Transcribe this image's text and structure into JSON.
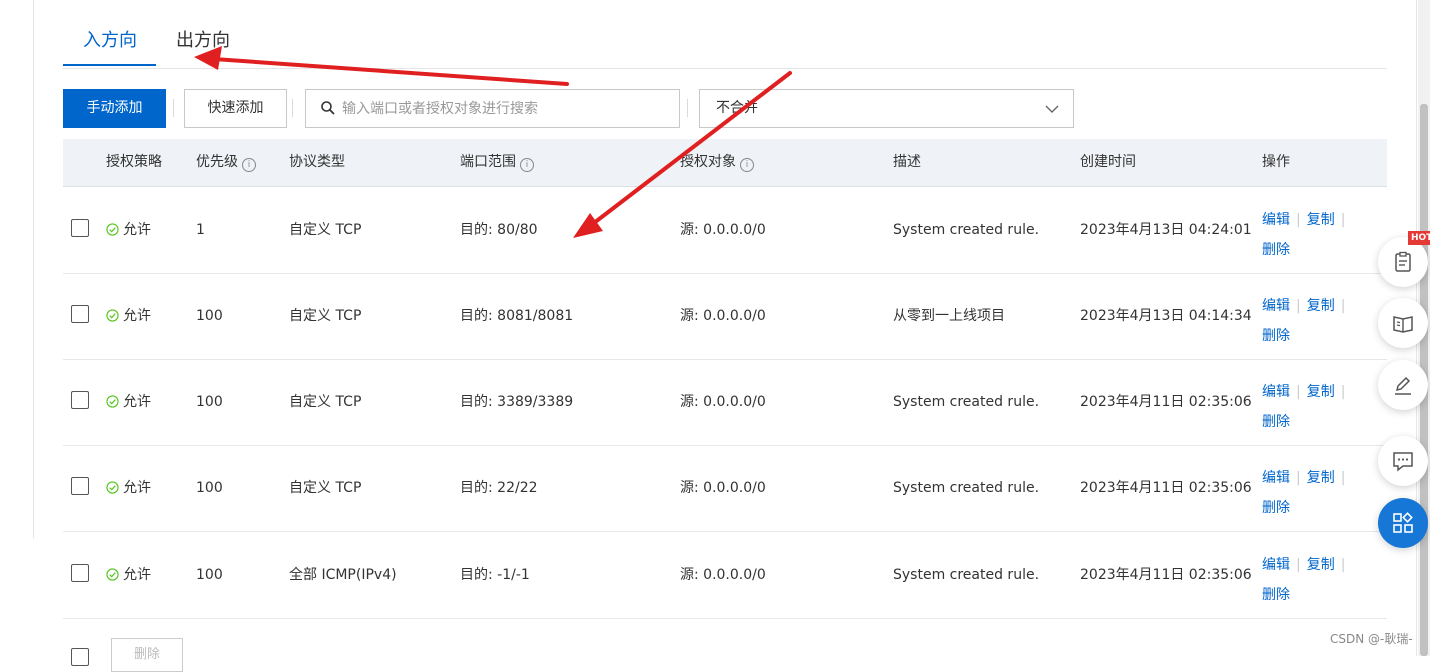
{
  "tabs": {
    "inbound": "入方向",
    "outbound": "出方向"
  },
  "toolbar": {
    "manual_add": "手动添加",
    "quick_add": "快速添加",
    "search_placeholder": "输入端口或者授权对象进行搜索",
    "merge_select_value": "不合并"
  },
  "table": {
    "headers": {
      "policy": "授权策略",
      "priority": "优先级",
      "protocol": "协议类型",
      "port_range": "端口范围",
      "auth_object": "授权对象",
      "description": "描述",
      "created_time": "创建时间",
      "actions": "操作"
    },
    "rows": [
      {
        "policy": "允许",
        "priority": "1",
        "protocol": "自定义 TCP",
        "port": "目的: 80/80",
        "source": "源: 0.0.0.0/0",
        "description": "System created rule.",
        "created": "2023年4月13日 04:24:01"
      },
      {
        "policy": "允许",
        "priority": "100",
        "protocol": "自定义 TCP",
        "port": "目的: 8081/8081",
        "source": "源: 0.0.0.0/0",
        "description": "从零到一上线项目",
        "created": "2023年4月13日 04:14:34"
      },
      {
        "policy": "允许",
        "priority": "100",
        "protocol": "自定义 TCP",
        "port": "目的: 3389/3389",
        "source": "源: 0.0.0.0/0",
        "description": "System created rule.",
        "created": "2023年4月11日 02:35:06"
      },
      {
        "policy": "允许",
        "priority": "100",
        "protocol": "自定义 TCP",
        "port": "目的: 22/22",
        "source": "源: 0.0.0.0/0",
        "description": "System created rule.",
        "created": "2023年4月11日 02:35:06"
      },
      {
        "policy": "允许",
        "priority": "100",
        "protocol": "全部 ICMP(IPv4)",
        "port": "目的: -1/-1",
        "source": "源: 0.0.0.0/0",
        "description": "System created rule.",
        "created": "2023年4月11日 02:35:06"
      }
    ],
    "actions": {
      "edit": "编辑",
      "copy": "复制",
      "delete": "删除"
    }
  },
  "footer": {
    "bulk_delete": "删除"
  },
  "side_tools": {
    "hot_badge": "HOT"
  },
  "watermark": "CSDN @-耿瑞-",
  "colors": {
    "primary": "#0066cc",
    "annotation_arrow": "#e02020",
    "allow_green": "#52c41a"
  }
}
